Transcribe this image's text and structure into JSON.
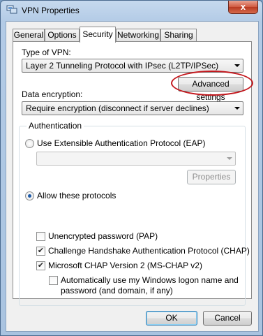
{
  "window": {
    "title": "VPN Properties",
    "close_glyph": "x"
  },
  "tabs": [
    {
      "label": "General"
    },
    {
      "label": "Options"
    },
    {
      "label": "Security"
    },
    {
      "label": "Networking"
    },
    {
      "label": "Sharing"
    }
  ],
  "active_tab": "Security",
  "security": {
    "vpn_type_label": "Type of VPN:",
    "vpn_type_value": "Layer 2 Tunneling Protocol with IPsec (L2TP/IPSec)",
    "advanced_settings_label": "Advanced settings",
    "data_encryption_label": "Data encryption:",
    "data_encryption_value": "Require encryption (disconnect if server declines)",
    "authentication": {
      "title": "Authentication",
      "use_eap_label": "Use Extensible Authentication Protocol (EAP)",
      "use_eap_selected": false,
      "eap_combo_value": "",
      "properties_label": "Properties",
      "allow_protocols_label": "Allow these protocols",
      "allow_protocols_selected": true,
      "protocols": [
        {
          "label": "Unencrypted password (PAP)",
          "checked": false
        },
        {
          "label": "Challenge Handshake Authentication Protocol (CHAP)",
          "checked": true
        },
        {
          "label": "Microsoft CHAP Version 2 (MS-CHAP v2)",
          "checked": true
        }
      ],
      "auto_logon_line1": "Automatically use my Windows logon name and",
      "auto_logon_line2": "password (and domain, if any)",
      "auto_logon_checked": false
    }
  },
  "footer": {
    "ok_label": "OK",
    "cancel_label": "Cancel"
  },
  "colors": {
    "highlight_ellipse": "#c3161c",
    "title_bar": "#b3cbe6",
    "radio_dot": "#1d5aa8"
  },
  "icons": {
    "title": "network-connection-icon",
    "close": "close-icon",
    "dropdown": "chevron-down-icon"
  }
}
